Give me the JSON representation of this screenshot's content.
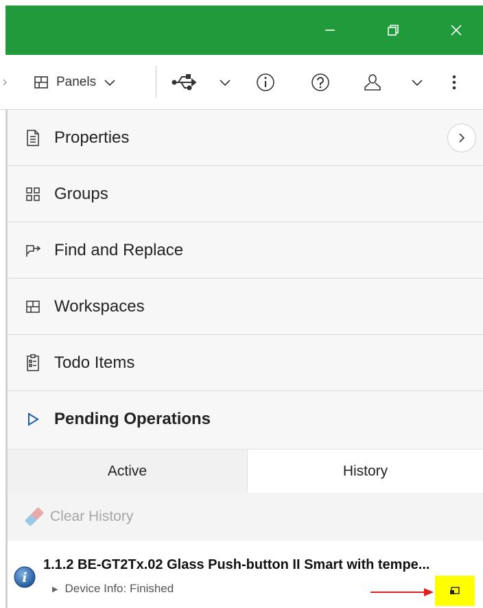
{
  "window": {
    "minimize_icon": "minimize-icon",
    "restore_icon": "restore-icon",
    "close_icon": "close-icon",
    "titlebar_color": "#209a3a"
  },
  "toolbar": {
    "panels_label": "Panels",
    "icons": [
      "panels-grid-icon",
      "chevron-down-icon",
      "usb-icon",
      "chevron-down-icon",
      "info-icon",
      "help-icon",
      "user-icon",
      "chevron-down-icon",
      "more-vertical-icon"
    ]
  },
  "panel": {
    "sections": [
      {
        "label": "Properties",
        "icon": "document-icon"
      },
      {
        "label": "Groups",
        "icon": "groups-icon"
      },
      {
        "label": "Find and Replace",
        "icon": "find-replace-icon"
      },
      {
        "label": "Workspaces",
        "icon": "workspaces-icon"
      },
      {
        "label": "Todo Items",
        "icon": "todo-icon"
      }
    ],
    "pending": {
      "label": "Pending Operations",
      "icon": "play-icon",
      "tabs": [
        {
          "label": "Active",
          "selected": false
        },
        {
          "label": "History",
          "selected": true
        }
      ],
      "clear_history_label": "Clear History",
      "operation": {
        "title": "1.1.2 BE-GT2Tx.02 Glass Push-button II Smart with tempe...",
        "detail": "Device Info: Finished",
        "icon": "info-icon",
        "action_icon": "open-window-icon"
      }
    }
  },
  "colors": {
    "accent_green": "#209a3a",
    "highlight_yellow": "#ffff00",
    "arrow_red": "#e0201c",
    "info_blue": "#1a5ea8"
  }
}
